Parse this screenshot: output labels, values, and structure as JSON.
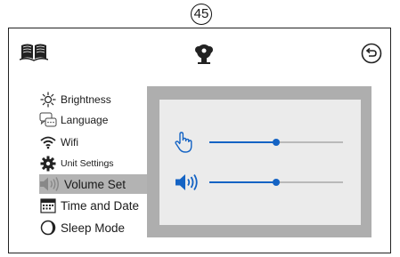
{
  "page_number": "45",
  "topbar": {
    "left_icon": "book-icon",
    "center_icon": "brand-logo-icon",
    "right_icon": "back-arrow-icon"
  },
  "menu": {
    "items": [
      {
        "label": "Brightness",
        "icon": "brightness-icon"
      },
      {
        "label": "Language",
        "icon": "language-icon"
      },
      {
        "label": "Wifi",
        "icon": "wifi-icon"
      },
      {
        "label": "Unit Settings",
        "icon": "gear-icon"
      },
      {
        "label": "Volume Set",
        "icon": "speaker-icon",
        "selected": true
      },
      {
        "label": "Time and Date",
        "icon": "calendar-icon"
      },
      {
        "label": "Sleep Mode",
        "icon": "sleep-icon"
      }
    ]
  },
  "panel": {
    "touch_volume": {
      "icon": "touch-hand-icon",
      "level": 0.5
    },
    "media_volume": {
      "icon": "speaker-icon",
      "level": 0.5
    }
  },
  "colors": {
    "accent": "#1463c4",
    "selected_bg": "#b3b3b3",
    "panel_bg": "#aeaeae",
    "panel_inner": "#ebebeb"
  }
}
